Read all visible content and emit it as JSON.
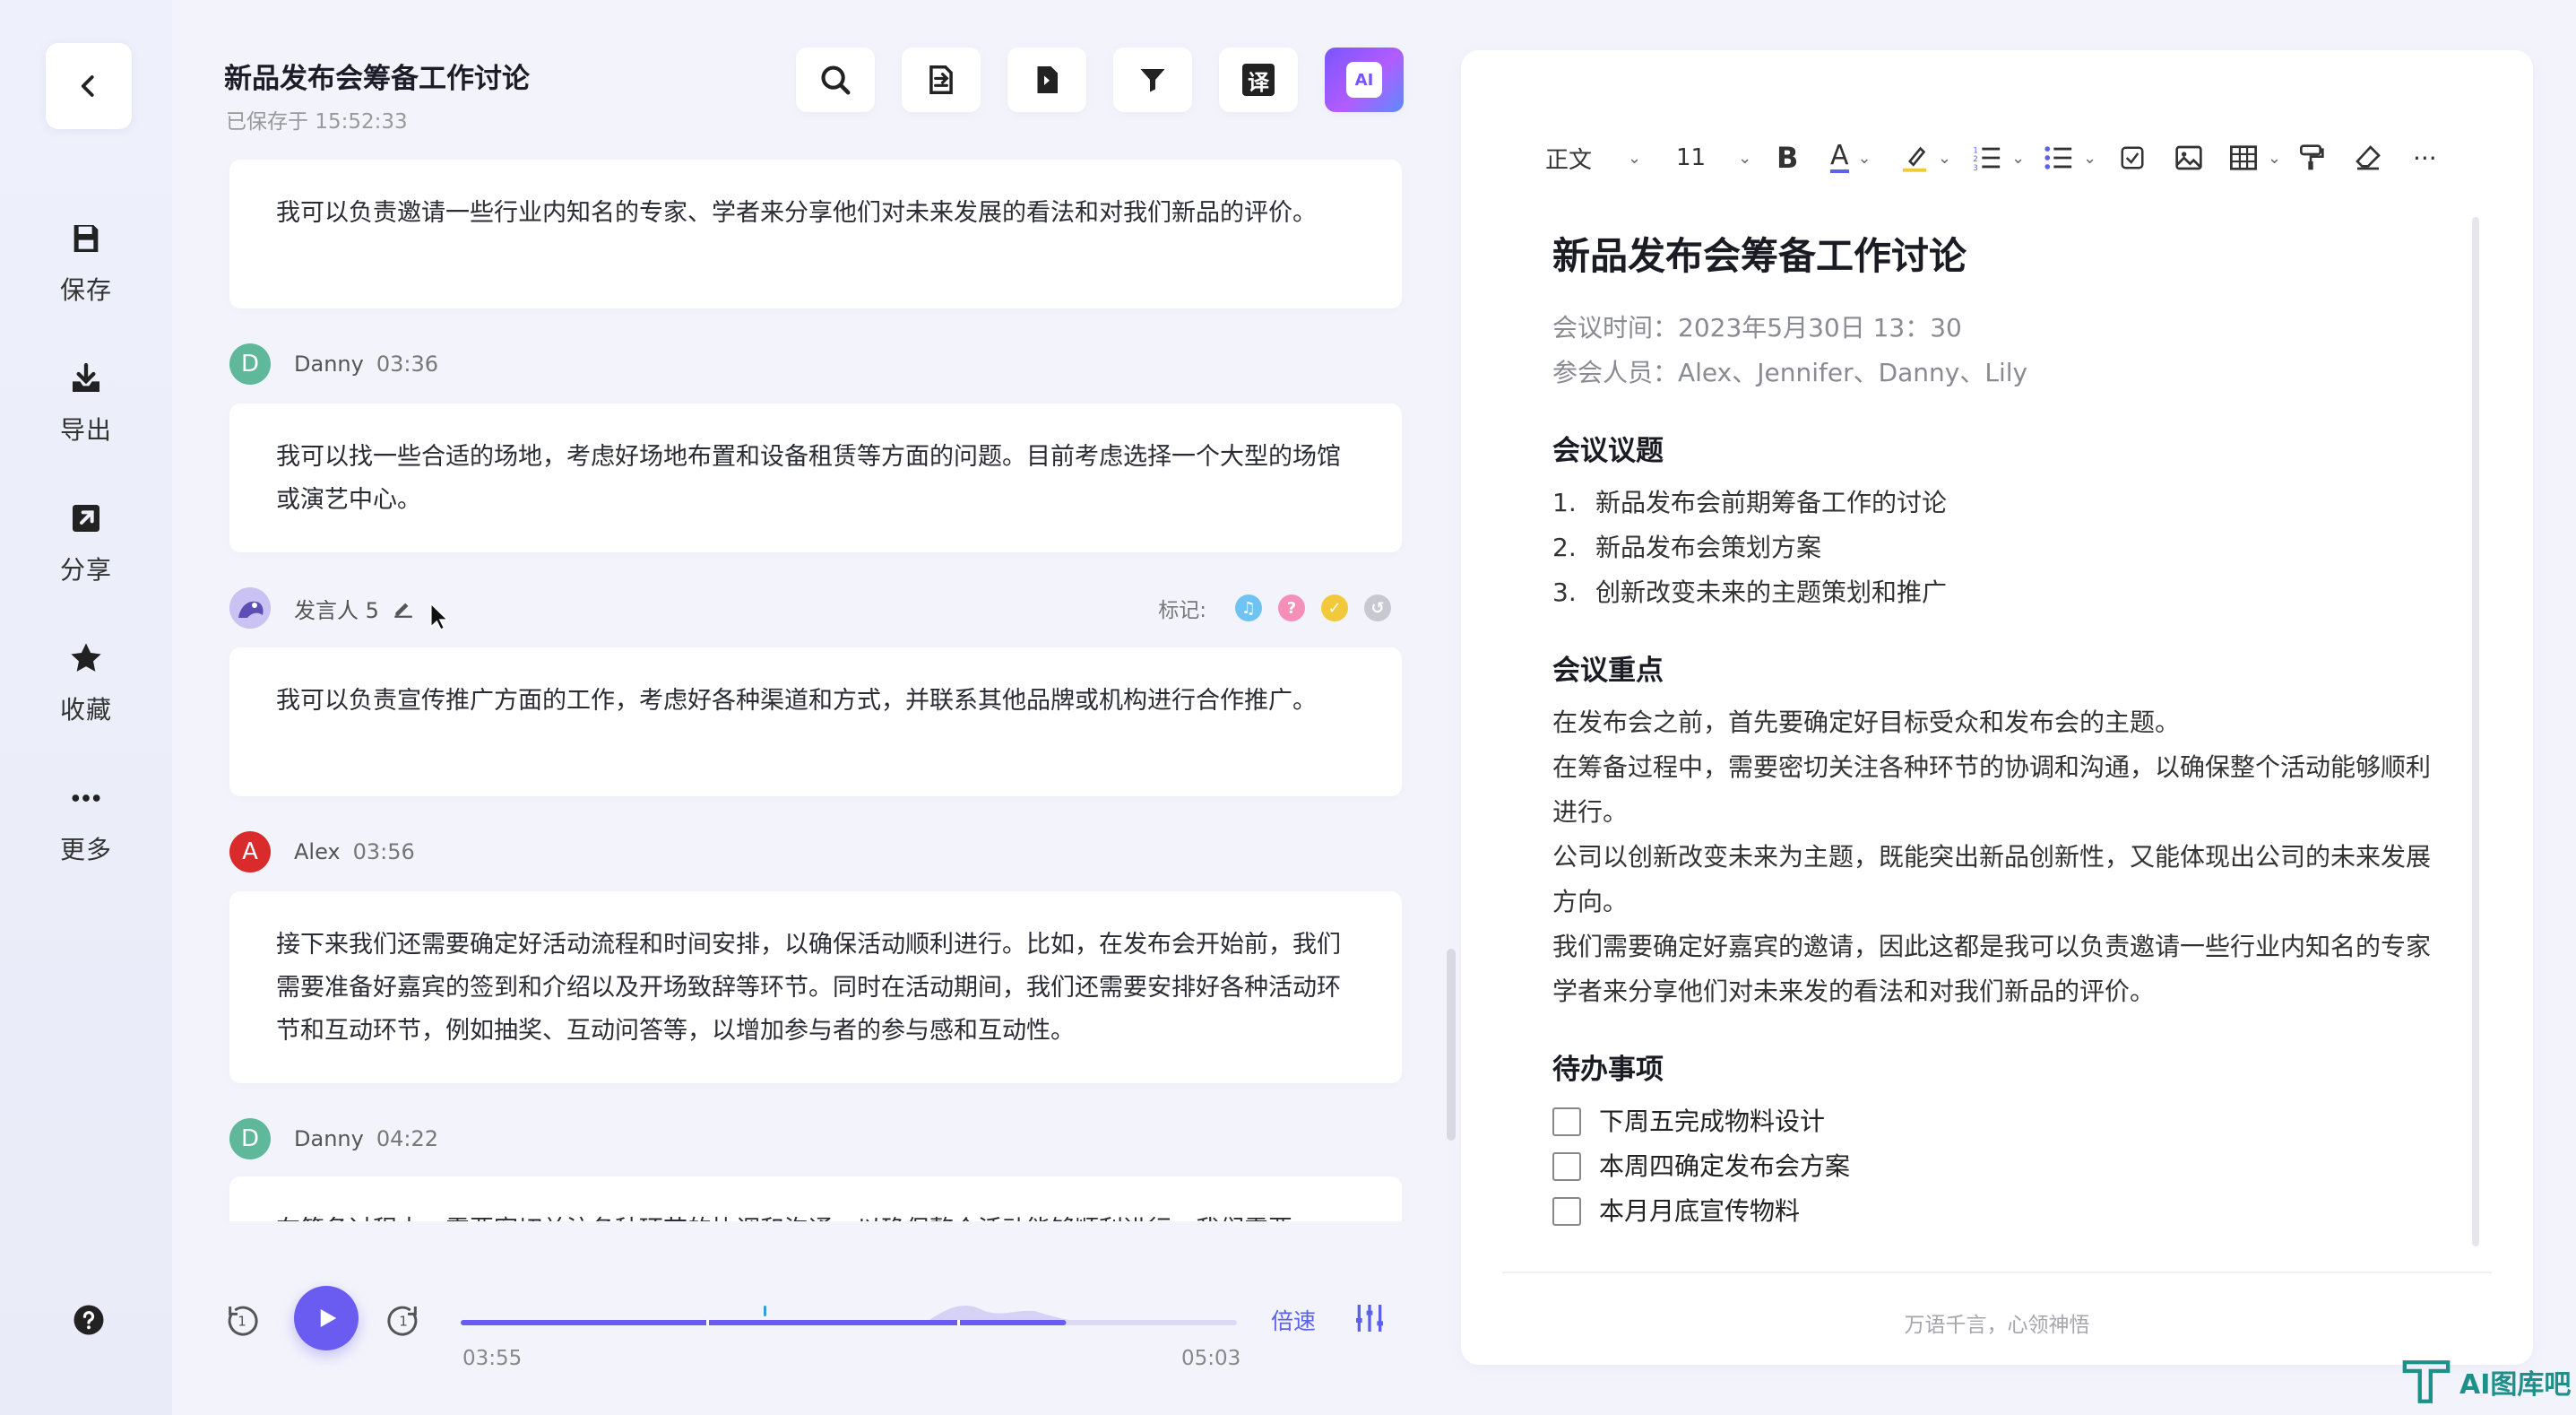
{
  "rail": {
    "items": [
      {
        "label": "保存",
        "icon": "save-icon"
      },
      {
        "label": "导出",
        "icon": "download-icon"
      },
      {
        "label": "分享",
        "icon": "share-icon"
      },
      {
        "label": "收藏",
        "icon": "star-icon"
      },
      {
        "label": "更多",
        "icon": "more-icon"
      }
    ]
  },
  "header": {
    "title": "新品发布会筹备工作讨论",
    "saved": "已保存于 15:52:33",
    "translate_glyph": "译",
    "ai_glyph": "AI"
  },
  "transcript": {
    "entries": [
      {
        "text": "我可以负责邀请一些行业内知名的专家、学者来分享他们对未来发展的看法和对我们新品的评价。"
      },
      {
        "name": "Danny",
        "time": "03:36",
        "initial": "D",
        "text": "我可以找一些合适的场地，考虑好场地布置和设备租赁等方面的问题。目前考虑选择一个大型的场馆或演艺中心。"
      },
      {
        "name": "发言人 5",
        "time": "",
        "initial": "",
        "text": "我可以负责宣传推广方面的工作，考虑好各种渠道和方式，并联系其他品牌或机构进行合作推广。"
      },
      {
        "name": "Alex",
        "time": "03:56",
        "initial": "A",
        "text": "接下来我们还需要确定好活动流程和时间安排，以确保活动顺利进行。比如，在发布会开始前，我们需要准备好嘉宾的签到和介绍以及开场致辞等环节。同时在活动期间，我们还需要安排好各种活动环节和互动环节，例如抽奖、互动问答等，以增加参与者的参与感和互动性。"
      },
      {
        "name": "Danny",
        "time": "04:22",
        "initial": "D",
        "text": "在筹备过程中，需要密切关注各种环节的协调和沟通，以确保整个活动能够顺利进行。我们需要"
      }
    ],
    "marks_label": "标记:",
    "marks": [
      {
        "glyph": "♫",
        "color": "#6fc3f3"
      },
      {
        "glyph": "?",
        "color": "#f58fb8"
      },
      {
        "glyph": "✓",
        "color": "#f3c93c"
      },
      {
        "glyph": "↺",
        "color": "#c8c8d0"
      }
    ]
  },
  "player": {
    "current": "03:55",
    "total": "05:03",
    "progress": 0.78,
    "speed_label": "倍速"
  },
  "editor": {
    "toolbar": {
      "style": "正文",
      "font_size": "11",
      "bold": "B",
      "font_color": "A",
      "more": "···"
    },
    "title": "新品发布会筹备工作讨论",
    "meta_time": "会议时间：2023年5月30日 13：30",
    "meta_people": "参会人员：Alex、Jennifer、Danny、Lily",
    "sec1": "会议议题",
    "topics": [
      {
        "n": "1.",
        "t": "新品发布会前期筹备工作的讨论"
      },
      {
        "n": "2.",
        "t": "新品发布会策划方案"
      },
      {
        "n": "3.",
        "t": "创新改变未来的主题策划和推广"
      }
    ],
    "sec2": "会议重点",
    "points": [
      "在发布会之前，首先要确定好目标受众和发布会的主题。",
      "在筹备过程中，需要密切关注各种环节的协调和沟通，以确保整个活动能够顺利进行。",
      "公司以创新改变未来为主题，既能突出新品创新性，又能体现出公司的未来发展方向。",
      "我们需要确定好嘉宾的邀请，因此这都是我可以负责邀请一些行业内知名的专家学者来分享他们对未来发的看法和对我们新品的评价。"
    ],
    "sec3": "待办事项",
    "todos": [
      "下周五完成物料设计",
      "本周四确定发布会方案",
      "本月月底宣传物料"
    ],
    "footer": "万语千言，心领神悟"
  },
  "watermark": "AI图库吧",
  "colors": {
    "accent": "#6a5cf0",
    "danny": "#5fb89a",
    "alex": "#d92b2b",
    "speaker5": "#7c6fd6"
  }
}
